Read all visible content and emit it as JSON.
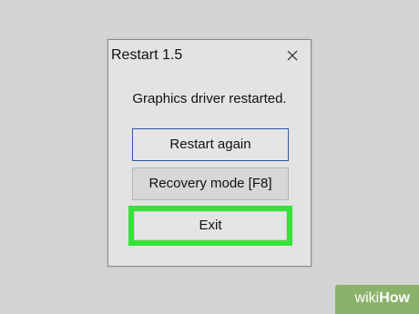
{
  "dialog": {
    "title": "Restart 1.5",
    "message": "Graphics driver restarted.",
    "buttons": {
      "restart_again": "Restart again",
      "recovery_mode": "Recovery mode [F8]",
      "exit": "Exit"
    }
  },
  "watermark": {
    "wiki": "wiki",
    "how": "How"
  },
  "colors": {
    "highlight": "#35e23a",
    "focus_border": "#2f5aa6",
    "watermark_bg": "#8ab26a"
  },
  "icons": {
    "close": "close-icon"
  }
}
